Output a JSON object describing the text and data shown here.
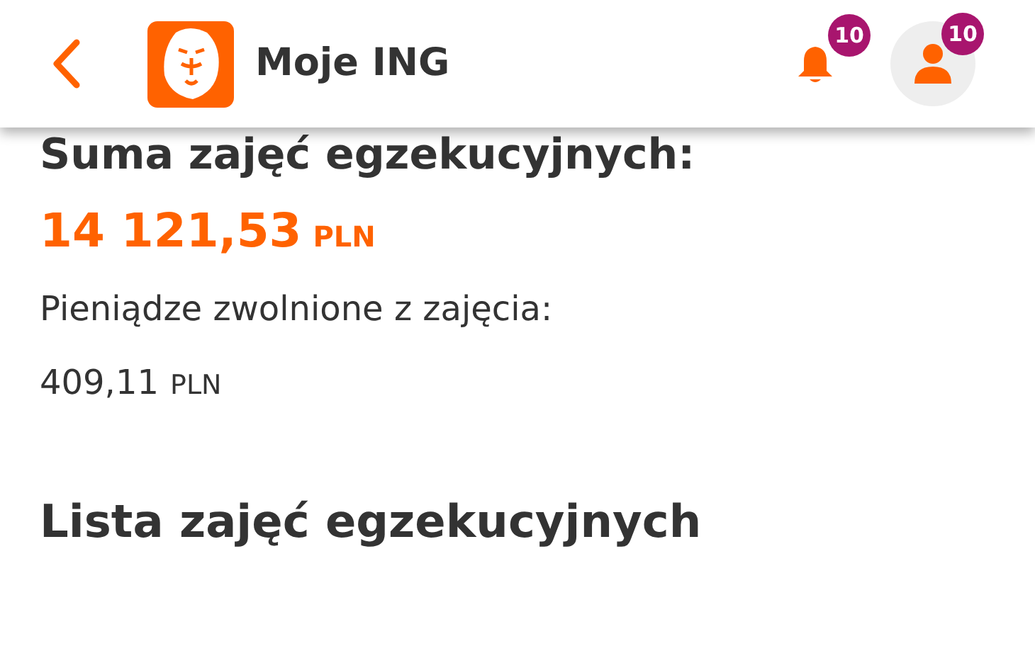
{
  "header": {
    "title": "Moje ING",
    "notifications_badge": "10",
    "profile_badge": "10"
  },
  "summary": {
    "heading": "Suma zajęć egzekucyjnych:",
    "amount": "14 121,53",
    "amount_currency": "PLN",
    "released_label": "Pieniądze zwolnione z zajęcia:",
    "released_amount": "409,11",
    "released_currency": "PLN"
  },
  "list": {
    "heading": "Lista zajęć egzekucyjnych"
  }
}
